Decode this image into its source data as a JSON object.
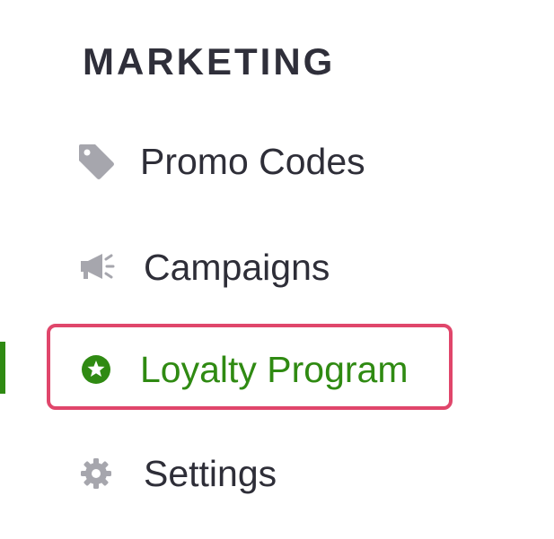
{
  "sidebar": {
    "section_title": "MARKETING",
    "items": [
      {
        "label": "Promo Codes",
        "icon": "tag-icon",
        "active": false
      },
      {
        "label": "Campaigns",
        "icon": "megaphone-icon",
        "active": false
      },
      {
        "label": "Loyalty Program",
        "icon": "star-circle-icon",
        "active": true
      },
      {
        "label": "Settings",
        "icon": "gear-icon",
        "active": false
      }
    ]
  },
  "colors": {
    "text": "#2e2e38",
    "icon_gray": "#a6a6ad",
    "active_green": "#2f8a12",
    "highlight_border": "#e0466b"
  }
}
